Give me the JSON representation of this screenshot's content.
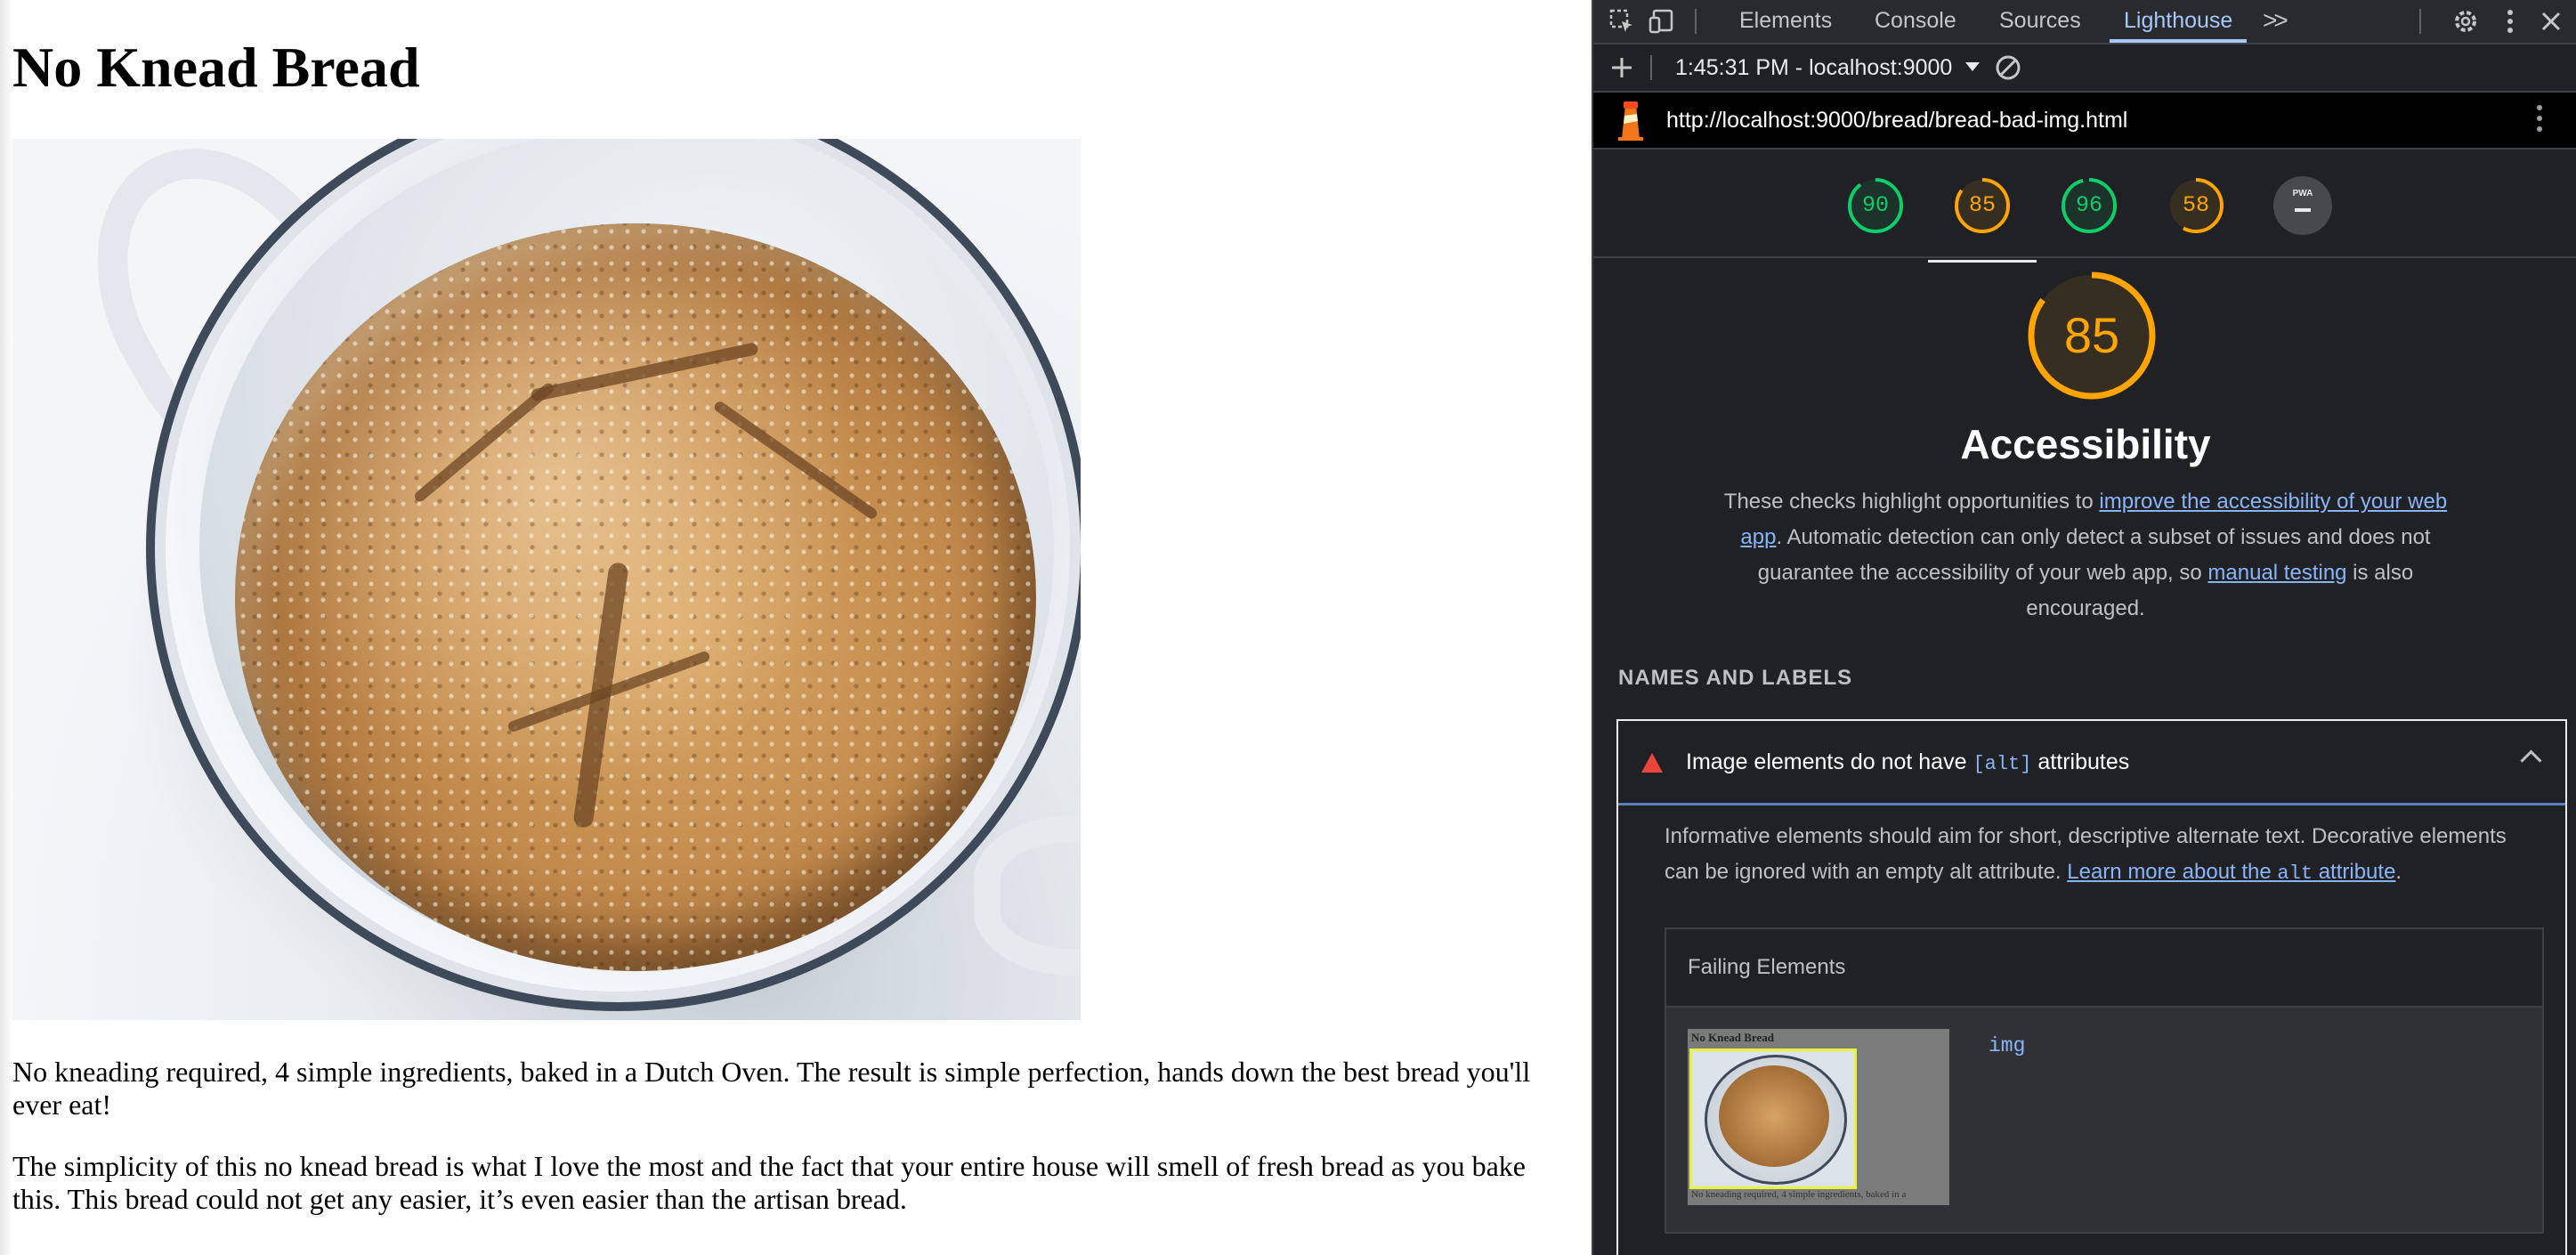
{
  "page": {
    "heading": "No Knead Bread",
    "paragraph1": "No kneading required, 4 simple ingredients, baked in a Dutch Oven. The result is simple perfection, hands down the best bread you'll ever eat!",
    "paragraph2": "The simplicity of this no knead bread is what I love the most and the fact that your entire house will smell of fresh bread as you bake this. This bread could not get any easier, it’s even easier than the artisan bread."
  },
  "devtools": {
    "tabs": [
      "Elements",
      "Console",
      "Sources",
      "Lighthouse"
    ],
    "active_tab": "Lighthouse",
    "more_tabs_icon": ">>",
    "icons": [
      "inspect-element-icon",
      "device-toolbar-icon",
      "settings-gear-icon",
      "kebab-menu-icon",
      "close-icon"
    ],
    "report_selector": "1:45:31 PM - localhost:9000",
    "report_url": "http://localhost:9000/bread/bread-bad-img.html",
    "scores": [
      {
        "value": "90",
        "color": "#0cce6b"
      },
      {
        "value": "85",
        "color": "#ffa400",
        "selected": true
      },
      {
        "value": "96",
        "color": "#0cce6b"
      },
      {
        "value": "58",
        "color": "#ffa400"
      }
    ],
    "pwa_label": "PWA",
    "category": {
      "score": "85",
      "score_fraction": 0.85,
      "title": "Accessibility",
      "desc_prefix": "These checks highlight opportunities to ",
      "desc_link1": "improve the accessibility of your web app",
      "desc_middle": ". Automatic detection can only detect a subset of issues and does not guarantee the accessibility of your web app, so ",
      "desc_link2": "manual testing",
      "desc_suffix": " is also encouraged."
    },
    "group_title": "NAMES AND LABELS",
    "audit": {
      "title_prefix": "Image elements do not have ",
      "title_code": "[alt]",
      "title_suffix": " attributes",
      "desc_prefix": "Informative elements should aim for short, descriptive alternate text. Decorative elements can be ignored with an empty alt attribute. ",
      "desc_link_prefix": "Learn more about the ",
      "desc_link_code": "alt",
      "desc_link_suffix": " attribute",
      "desc_end": ".",
      "failing_header": "Failing Elements",
      "node_label": "img",
      "thumb_title": "No Knead Bread",
      "thumb_text": "No kneading required, 4 simple ingredients, baked in a"
    }
  }
}
